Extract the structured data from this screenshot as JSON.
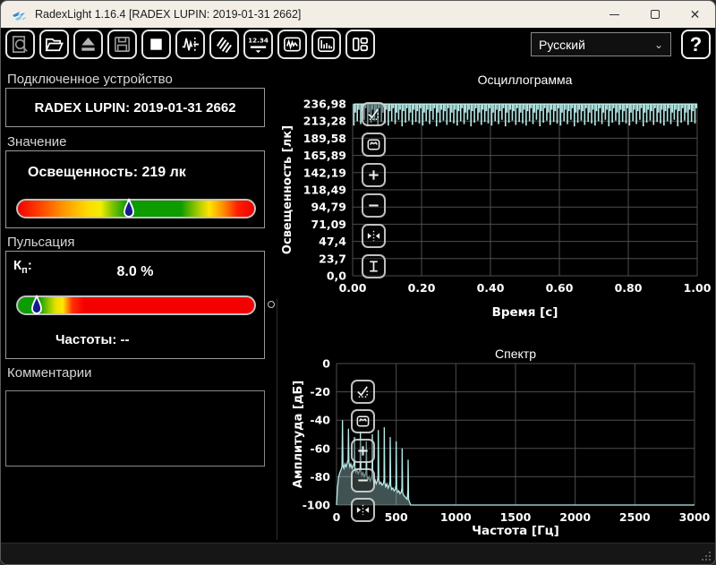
{
  "window": {
    "title": "RadexLight 1.16.4 [RADEX LUPIN: 2019-01-31 2662]"
  },
  "toolbar": {
    "buttons": [
      {
        "name": "zoom-document",
        "enabled": false
      },
      {
        "name": "open-folder",
        "enabled": true
      },
      {
        "name": "eject-device",
        "enabled": false
      },
      {
        "name": "save-file",
        "enabled": false
      },
      {
        "name": "stop-measurement",
        "enabled": true
      },
      {
        "name": "pulse-measure",
        "enabled": true
      },
      {
        "name": "wave-sensor",
        "enabled": true
      },
      {
        "name": "numeric-display",
        "label": "12.34",
        "enabled": true
      },
      {
        "name": "oscillogram-view",
        "enabled": true
      },
      {
        "name": "spectrum-view",
        "enabled": true
      },
      {
        "name": "layout-panels",
        "enabled": true
      }
    ],
    "language": {
      "value": "Русский"
    },
    "help_label": "?"
  },
  "device_section": {
    "label": "Подключенное устройство",
    "device": "RADEX LUPIN: 2019-01-31 2662"
  },
  "value_section": {
    "label": "Значение",
    "reading": "Освещенность: 219 лк",
    "marker_pct": 47,
    "gradient": [
      {
        "c": "#f00000",
        "p": 0
      },
      {
        "c": "#ff4000",
        "p": 9
      },
      {
        "c": "#ff9400",
        "p": 19
      },
      {
        "c": "#ffd800",
        "p": 29
      },
      {
        "c": "#f2ee00",
        "p": 35
      },
      {
        "c": "#7fc400",
        "p": 40
      },
      {
        "c": "#0c9c00",
        "p": 46
      },
      {
        "c": "#0c9c00",
        "p": 69
      },
      {
        "c": "#b5d000",
        "p": 77
      },
      {
        "c": "#ffe400",
        "p": 81
      },
      {
        "c": "#ff8c00",
        "p": 87
      },
      {
        "c": "#ff1e00",
        "p": 93
      },
      {
        "c": "#f00000",
        "p": 100
      }
    ]
  },
  "pulsation_section": {
    "label": "Пульсация",
    "kp_label": "К",
    "kp_sub": "п",
    "kp_colon": ":",
    "kp_value": "8.0 %",
    "marker_pct": 8,
    "freq_text": "Частоты: --",
    "gradient": [
      {
        "c": "#0c9c00",
        "p": 0
      },
      {
        "c": "#0c9c00",
        "p": 9
      },
      {
        "c": "#8cc800",
        "p": 13
      },
      {
        "c": "#e8e000",
        "p": 16
      },
      {
        "c": "#ffe800",
        "p": 19
      },
      {
        "c": "#ff3000",
        "p": 23
      },
      {
        "c": "#f50000",
        "p": 28
      },
      {
        "c": "#f50000",
        "p": 100
      }
    ]
  },
  "comments_section": {
    "label": "Комментарии",
    "text": ""
  },
  "chart_data": [
    {
      "type": "line",
      "title": "Осциллограмма",
      "xlabel": "Время [с]",
      "ylabel": "Освещенность [лк]",
      "x_ticks": [
        "0.00",
        "0.20",
        "0.40",
        "0.60",
        "0.80",
        "1.00"
      ],
      "y_ticks": [
        "236,98",
        "213,28",
        "189,58",
        "165,89",
        "142,19",
        "118,49",
        "94,79",
        "71,09",
        "47,4",
        "23,7",
        "0,0"
      ],
      "xlim": [
        0,
        1
      ],
      "ylim": [
        0,
        236.98
      ],
      "grid": true,
      "series": [
        {
          "name": "illuminance",
          "color": "#b6ebe9",
          "signal": {
            "kind": "flicker-comb",
            "periods": 100,
            "top": 236.8,
            "spike_bottoms": [
              207,
              213,
              209,
              215,
              206,
              211,
              214,
              208,
              212,
              210
            ],
            "band_bottoms": [
              225,
              229,
              227,
              231
            ]
          }
        }
      ]
    },
    {
      "type": "area",
      "title": "Спектр",
      "xlabel": "Частота [Гц]",
      "ylabel": "Амплитуда [дБ]",
      "x_ticks": [
        "0",
        "500",
        "1000",
        "1500",
        "2000",
        "2500",
        "3000"
      ],
      "y_ticks": [
        "0",
        "-20",
        "-40",
        "-60",
        "-80",
        "-100"
      ],
      "xlim": [
        0,
        3000
      ],
      "ylim": [
        -100,
        0
      ],
      "grid": true,
      "series": [
        {
          "name": "amplitude",
          "color": "#b6ebe9",
          "points": [
            [
              0,
              -100
            ],
            [
              8,
              -88
            ],
            [
              18,
              -80
            ],
            [
              28,
              -77
            ],
            [
              38,
              -75
            ],
            [
              46,
              -73
            ],
            [
              50,
              -40
            ],
            [
              54,
              -72
            ],
            [
              62,
              -74
            ],
            [
              70,
              -71
            ],
            [
              80,
              -73
            ],
            [
              90,
              -70
            ],
            [
              97,
              -68
            ],
            [
              100,
              -46
            ],
            [
              104,
              -70
            ],
            [
              112,
              -73
            ],
            [
              120,
              -71
            ],
            [
              130,
              -74
            ],
            [
              140,
              -72
            ],
            [
              148,
              -70
            ],
            [
              150,
              -52
            ],
            [
              154,
              -74
            ],
            [
              162,
              -77
            ],
            [
              172,
              -75
            ],
            [
              182,
              -78
            ],
            [
              192,
              -76
            ],
            [
              198,
              -73
            ],
            [
              200,
              -48
            ],
            [
              204,
              -76
            ],
            [
              212,
              -79
            ],
            [
              222,
              -77
            ],
            [
              232,
              -80
            ],
            [
              242,
              -78
            ],
            [
              248,
              -76
            ],
            [
              250,
              -55
            ],
            [
              254,
              -79
            ],
            [
              262,
              -82
            ],
            [
              272,
              -80
            ],
            [
              282,
              -83
            ],
            [
              292,
              -81
            ],
            [
              298,
              -79
            ],
            [
              300,
              -50
            ],
            [
              304,
              -81
            ],
            [
              312,
              -84
            ],
            [
              322,
              -82
            ],
            [
              332,
              -85
            ],
            [
              342,
              -83
            ],
            [
              348,
              -80
            ],
            [
              350,
              -47
            ],
            [
              354,
              -82
            ],
            [
              362,
              -85
            ],
            [
              372,
              -84
            ],
            [
              382,
              -86
            ],
            [
              392,
              -85
            ],
            [
              398,
              -82
            ],
            [
              400,
              -45
            ],
            [
              404,
              -84
            ],
            [
              412,
              -87
            ],
            [
              422,
              -85
            ],
            [
              432,
              -88
            ],
            [
              442,
              -86
            ],
            [
              448,
              -83
            ],
            [
              450,
              -52
            ],
            [
              454,
              -86
            ],
            [
              462,
              -89
            ],
            [
              472,
              -88
            ],
            [
              482,
              -90
            ],
            [
              492,
              -89
            ],
            [
              498,
              -86
            ],
            [
              500,
              -55
            ],
            [
              504,
              -88
            ],
            [
              512,
              -91
            ],
            [
              522,
              -90
            ],
            [
              532,
              -92
            ],
            [
              542,
              -91
            ],
            [
              548,
              -88
            ],
            [
              550,
              -60
            ],
            [
              554,
              -91
            ],
            [
              562,
              -93
            ],
            [
              572,
              -94
            ],
            [
              582,
              -95
            ],
            [
              592,
              -96
            ],
            [
              598,
              -90
            ],
            [
              600,
              -68
            ],
            [
              604,
              -96
            ],
            [
              612,
              -98
            ],
            [
              622,
              -100
            ],
            [
              3000,
              -100
            ]
          ]
        }
      ]
    }
  ]
}
